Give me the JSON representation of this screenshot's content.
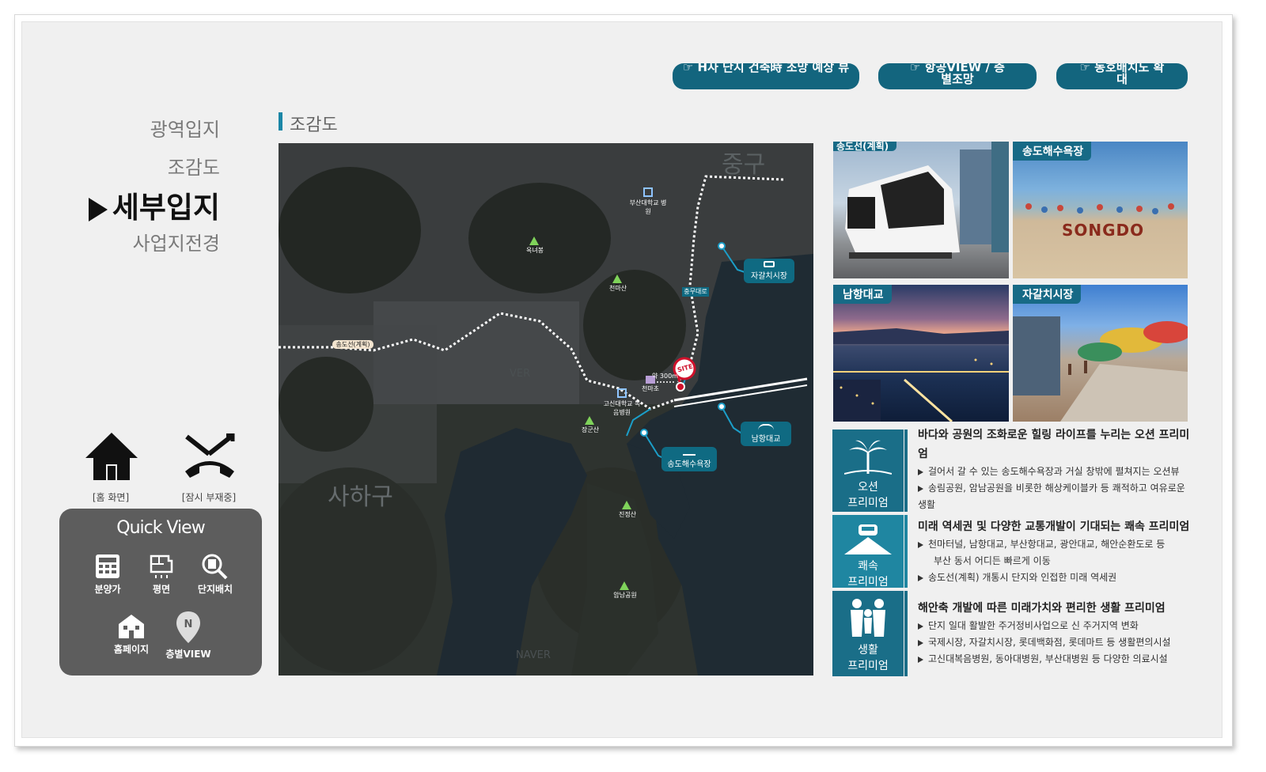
{
  "top_buttons": [
    "☞ H사 단지 건축時 조망 예상 뷰",
    "☞ 항공VIEW / 층별조망",
    "☞ 동호배치도 확대"
  ],
  "nav": {
    "items": [
      "광역입지",
      "조감도",
      "세부입지",
      "사업지전경"
    ],
    "active": "세부입지"
  },
  "home_caption": "[홈 화면]",
  "away_caption": "[잠시 부재중]",
  "quick_view": {
    "title": "Quick View",
    "items": [
      "분양가",
      "평면",
      "단지배치",
      "홈페이지",
      "층별VIEW"
    ]
  },
  "section_title": "조감도",
  "map": {
    "districts": [
      "중구",
      "사하구"
    ],
    "mountains": [
      "옥녀봉",
      "천마산",
      "장군산",
      "진정산",
      "암남공원"
    ],
    "places": [
      "부산대학교 병원",
      "고신대학교 복음병원",
      "천마초"
    ],
    "line_label": "송도선(계획)",
    "station_label": "충무대로",
    "site": "SITE",
    "distance": "약 300m",
    "badges": [
      "자갈치시장",
      "남항대교",
      "송도해수욕장"
    ],
    "watermarks": [
      "VER",
      "NAVER"
    ]
  },
  "photos": [
    {
      "label": "송도선(계획)"
    },
    {
      "label": "송도해수욕장",
      "sign": "SONGDO"
    },
    {
      "label": "남항대교"
    },
    {
      "label": "자갈치시장"
    }
  ],
  "premiums": [
    {
      "icon_label": [
        "오션",
        "프리미엄"
      ],
      "title": "바다와 공원의 조화로운 힐링 라이프를 누리는 오션 프리미엄",
      "lines": [
        "걸어서 갈 수 있는 송도해수욕장과 거실 창밖에 펼쳐지는 오션뷰",
        "송림공원, 암남공원을 비롯한 해상케이블카 등 쾌적하고 여유로운 생활"
      ]
    },
    {
      "icon_label": [
        "쾌속",
        "프리미엄"
      ],
      "title": "미래 역세권 및 다양한 교통개발이 기대되는 쾌속 프리미엄",
      "lines": [
        "천마터널, 남항대교, 부산항대교, 광안대교, 해안순환도로 등",
        "부산 동서 어디든 빠르게 이동",
        "송도선(계획) 개통시 단지와 인접한 미래 역세권"
      ]
    },
    {
      "icon_label": [
        "생활",
        "프리미엄"
      ],
      "title": "해안축 개발에 따른 미래가치와 편리한 생활 프리미엄",
      "lines": [
        "단지 일대 활발한 주거정비사업으로 신 주거지역 변화",
        "국제시장, 자갈치시장, 롯데백화점, 롯데마트 등 생활편의시설",
        "고신대복음병원, 동아대병원, 부산대병원 등 다양한 의료시설"
      ]
    }
  ]
}
